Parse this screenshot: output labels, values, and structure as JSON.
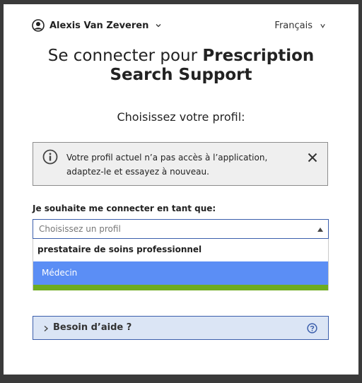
{
  "header": {
    "user_name": "Alexis Van Zeveren",
    "language": "Français",
    "icons": {
      "user": "user-circle-icon",
      "user_chevron": "chevron-down-icon",
      "language_chevron": "chevron-down-icon"
    }
  },
  "title": {
    "prefix": "Se connecter pour ",
    "app_name_line1": "Prescription",
    "app_name_line2": "Search Support"
  },
  "subtitle": "Choisissez votre profil:",
  "alert": {
    "message": "Votre profil actuel n’a pas accès à l’application, adaptez-le et essayez à nouveau.",
    "icons": {
      "info": "info-circle-icon",
      "close": "close-icon"
    }
  },
  "profile_field": {
    "label": "Je souhaite me connecter en tant que:",
    "placeholder": "Choisissez un profil",
    "dropdown": {
      "group_label": "prestataire de soins professionnel",
      "options": [
        "Médecin"
      ],
      "highlighted": "Médecin"
    }
  },
  "help": {
    "label": "Besoin d’aide ?",
    "icons": {
      "expand": "chevron-right-icon",
      "question": "question-circle-icon"
    }
  },
  "colors": {
    "background": "#3a3a3a",
    "card": "#ffffff",
    "select_border": "#3b5eab",
    "option_highlight": "#5b8ef5",
    "accent_green": "#6eac1f",
    "help_background": "#dbe5f5",
    "alert_background": "#efefef"
  }
}
